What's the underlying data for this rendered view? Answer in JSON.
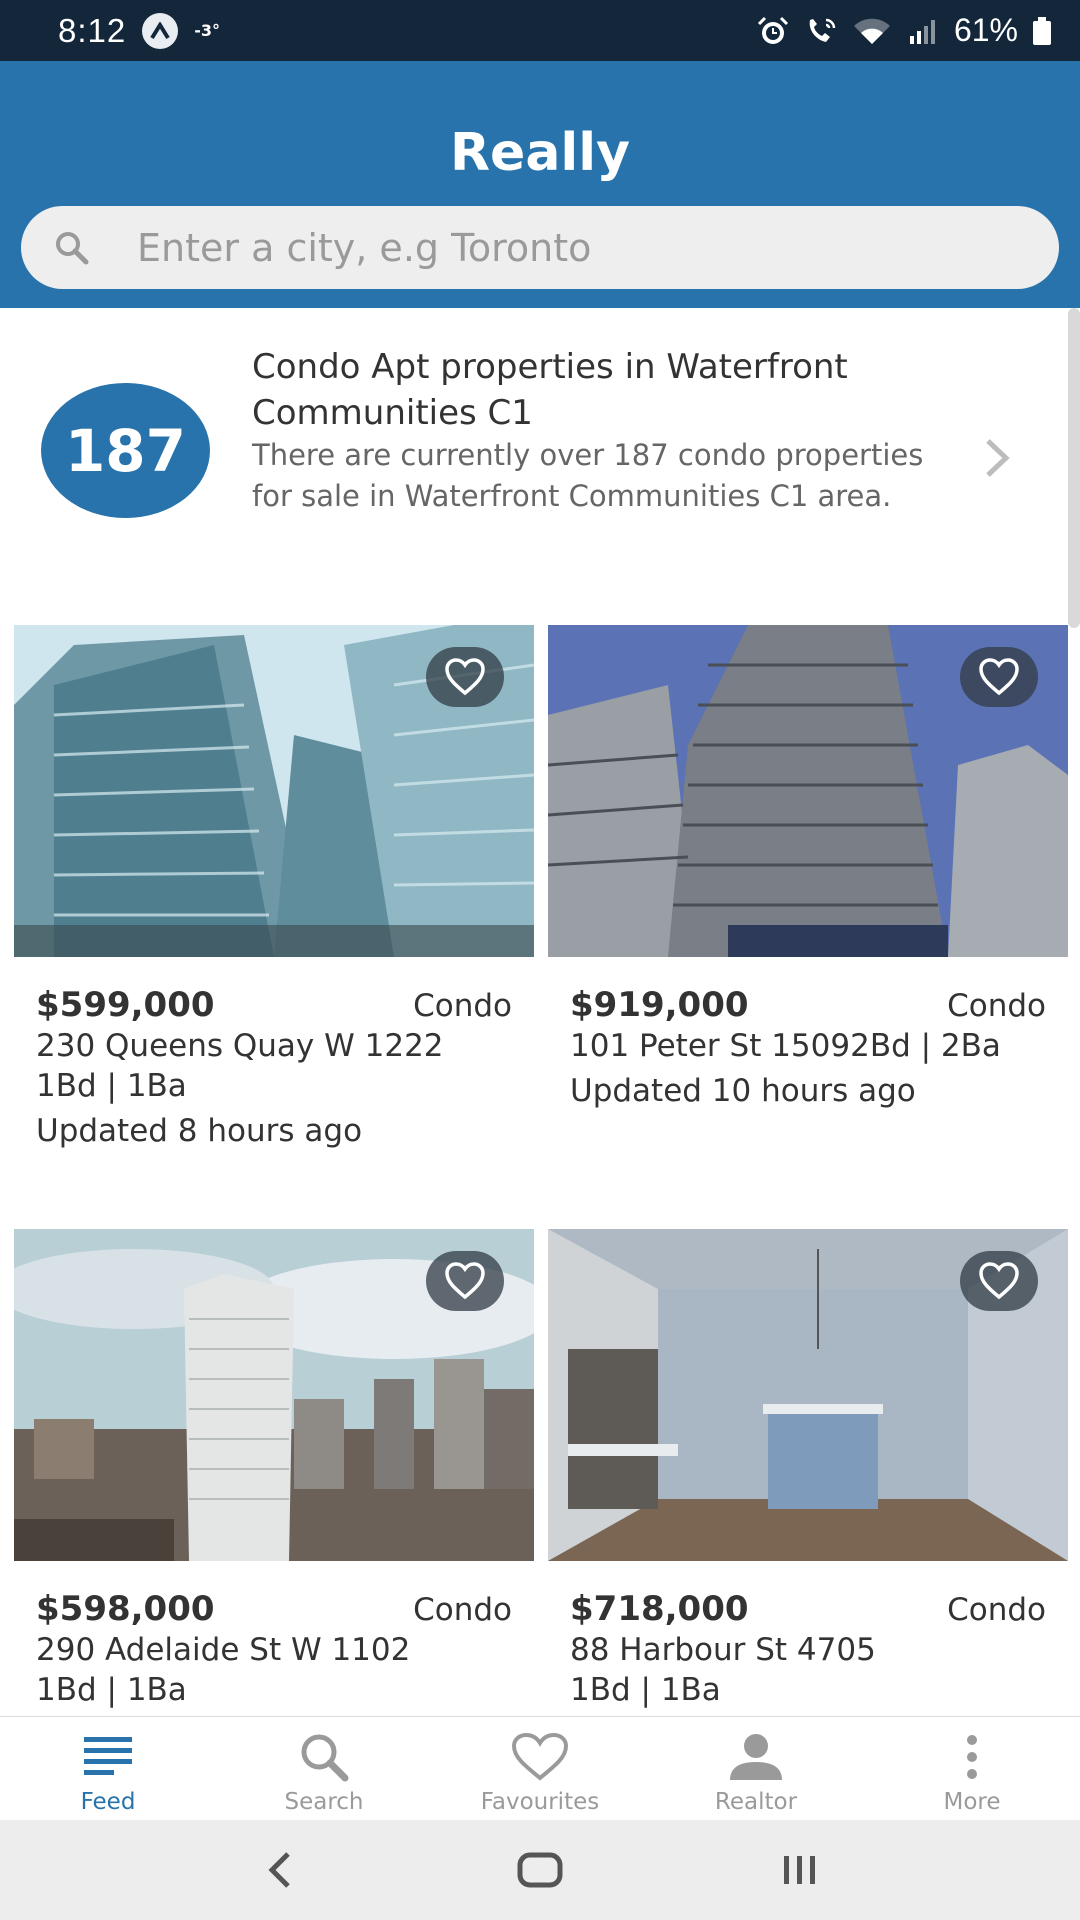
{
  "status_bar": {
    "time": "8:12",
    "temperature": "-3°",
    "battery": "61%"
  },
  "header": {
    "title": "Really",
    "search_placeholder": "Enter a city, e.g Toronto"
  },
  "summary": {
    "count": "187",
    "title": "Condo Apt properties in Waterfront Communities C1",
    "description": "There are currently over 187 condo properties for sale in Waterfront Communities C1 area."
  },
  "listings": [
    {
      "price": "$599,000",
      "type": "Condo",
      "address": "230 Queens Quay W 1222",
      "details": "1Bd | 1Ba",
      "updated": "Updated 8 hours ago",
      "photo_colors": {
        "sky": "#cfe6ef",
        "building": "#5c8a99",
        "accent": "#8fb7c4"
      }
    },
    {
      "price": "$919,000",
      "type": "Condo",
      "address": "101 Peter St 15092Bd | 2Ba",
      "details": "",
      "updated": "Updated 10 hours ago",
      "photo_colors": {
        "sky": "#5b72b5",
        "building": "#7a7e86",
        "accent": "#a7abb2"
      }
    },
    {
      "price": "$598,000",
      "type": "Condo",
      "address": "290 Adelaide St W 1102",
      "details": "1Bd | 1Ba",
      "updated": "",
      "photo_colors": {
        "sky": "#b9cfd6",
        "building": "#e4e6e6",
        "accent": "#6b6159"
      }
    },
    {
      "price": "$718,000",
      "type": "Condo",
      "address": "88 Harbour St 4705",
      "details": "1Bd | 1Ba",
      "updated": "",
      "photo_colors": {
        "sky": "#aeb9c4",
        "building": "#7f9bbc",
        "accent": "#6e5b4a"
      }
    }
  ],
  "bottom_nav": [
    {
      "label": "Feed",
      "icon": "feed-icon",
      "active": true
    },
    {
      "label": "Search",
      "icon": "search-icon",
      "active": false
    },
    {
      "label": "Favourites",
      "icon": "heart-icon",
      "active": false
    },
    {
      "label": "Realtor",
      "icon": "person-icon",
      "active": false
    },
    {
      "label": "More",
      "icon": "more-vertical-icon",
      "active": false
    }
  ],
  "colors": {
    "brand": "#2873ab",
    "status_bar": "#13263a",
    "inactive_nav": "#9a9a9a"
  }
}
